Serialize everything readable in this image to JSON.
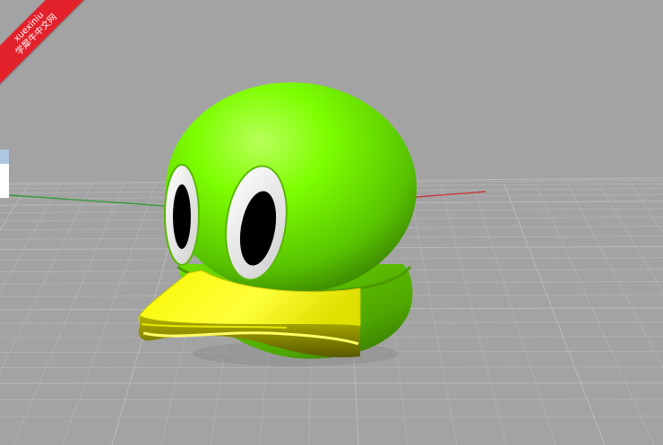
{
  "watermark": {
    "line1": "xuexiniu",
    "line2": "学犀牛中文网"
  },
  "viewport": {
    "background": "#a3a3a3",
    "grid_color": "#b8b8b8",
    "x_axis_color": "#c83a3a",
    "y_axis_color": "#3a9a3a"
  },
  "model": {
    "head_color": "#7dff00",
    "beak_color": "#ffff00",
    "eye_white": "#f5f5f5",
    "pupil_color": "#000000"
  }
}
